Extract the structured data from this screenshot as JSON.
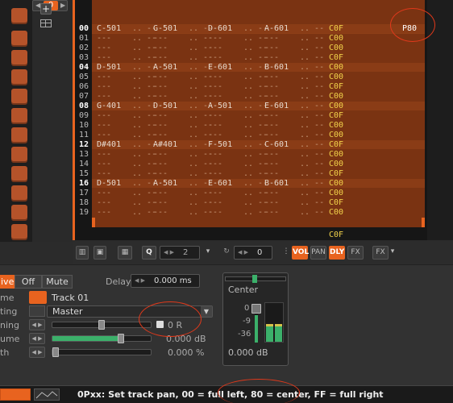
{
  "sidebar": {
    "spinner_value": "0",
    "add_symbol": "+"
  },
  "pattern": {
    "rows": [
      {
        "num": "00",
        "c1": "C-501",
        "c2": "G-501",
        "c3": "D-601",
        "c4": "A-601",
        "fx": "C0F",
        "extra": "P80"
      },
      {
        "num": "01",
        "c1": "",
        "c2": "",
        "c3": "",
        "c4": "",
        "fx": "C00"
      },
      {
        "num": "02",
        "c1": "",
        "c2": "",
        "c3": "",
        "c4": "",
        "fx": "C00"
      },
      {
        "num": "03",
        "c1": "",
        "c2": "",
        "c3": "",
        "c4": "",
        "fx": "C0F"
      },
      {
        "num": "04",
        "c1": "D-501",
        "c2": "A-501",
        "c3": "E-601",
        "c4": "B-601",
        "fx": "C00"
      },
      {
        "num": "05",
        "c1": "",
        "c2": "",
        "c3": "",
        "c4": "",
        "fx": "C00"
      },
      {
        "num": "06",
        "c1": "",
        "c2": "",
        "c3": "",
        "c4": "",
        "fx": "C0F"
      },
      {
        "num": "07",
        "c1": "",
        "c2": "",
        "c3": "",
        "c4": "",
        "fx": "C00"
      },
      {
        "num": "08",
        "c1": "G-401",
        "c2": "D-501",
        "c3": "A-501",
        "c4": "E-601",
        "fx": "C00"
      },
      {
        "num": "09",
        "c1": "",
        "c2": "",
        "c3": "",
        "c4": "",
        "fx": "C0F"
      },
      {
        "num": "10",
        "c1": "",
        "c2": "",
        "c3": "",
        "c4": "",
        "fx": "C00"
      },
      {
        "num": "11",
        "c1": "",
        "c2": "",
        "c3": "",
        "c4": "",
        "fx": "C00"
      },
      {
        "num": "12",
        "c1": "D#401",
        "c2": "A#401",
        "c3": "F-501",
        "c4": "C-601",
        "fx": "C0F"
      },
      {
        "num": "13",
        "c1": "",
        "c2": "",
        "c3": "",
        "c4": "",
        "fx": "C00"
      },
      {
        "num": "14",
        "c1": "",
        "c2": "",
        "c3": "",
        "c4": "",
        "fx": "C00"
      },
      {
        "num": "15",
        "c1": "",
        "c2": "",
        "c3": "",
        "c4": "",
        "fx": "C0F"
      },
      {
        "num": "16",
        "c1": "D-501",
        "c2": "A-501",
        "c3": "E-601",
        "c4": "B-601",
        "fx": "C00"
      },
      {
        "num": "17",
        "c1": "",
        "c2": "",
        "c3": "",
        "c4": "",
        "fx": "C00"
      },
      {
        "num": "18",
        "c1": "",
        "c2": "",
        "c3": "",
        "c4": "",
        "fx": "C0F"
      },
      {
        "num": "19",
        "c1": "",
        "c2": "",
        "c3": "",
        "c4": "",
        "fx": "C00"
      }
    ],
    "last_fx": "C0F"
  },
  "toolbar": {
    "step_value": "2",
    "octave_value": "0",
    "vol_label": "VOL",
    "pan_label": "PAN",
    "dly_label": "DLY",
    "fx_label": "FX",
    "fx2_label": "FX"
  },
  "track": {
    "active_label": "ive",
    "off_label": "Off",
    "mute_label": "Mute",
    "delay_label": "Delay",
    "delay_value": "0.000 ms",
    "name_label": "me",
    "name_value": "Track 01",
    "routing_label": "ting",
    "routing_value": "Master",
    "panning_label": "ning",
    "panning_value": "0 R",
    "volume_label": "ume",
    "volume_value": "0.000 dB",
    "width_label": "th",
    "width_value": "0.000 %"
  },
  "mixer": {
    "label": "Center",
    "scale": [
      "0",
      "-9",
      "-36"
    ],
    "db_value": "0.000 dB"
  },
  "status": {
    "text": "0Pxx: Set track pan, 00 = full left, 80 = center, FF = full right"
  },
  "colors": {
    "accent": "#e8631f",
    "pattern_bg": "#7a3312",
    "fx_text": "#f2d24a",
    "annotation": "#e0391b"
  }
}
